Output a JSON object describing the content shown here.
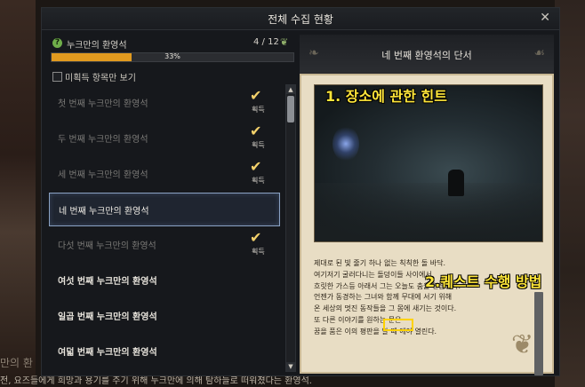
{
  "window": {
    "title": "전체 수집 현황",
    "close_icon": "✕"
  },
  "collection": {
    "name": "누크만의 환영석",
    "count": "4 / 12",
    "progress_percent": 33,
    "progress_text": "33%"
  },
  "filter": {
    "label": "미획득 항목만 보기",
    "checked": false
  },
  "list": {
    "items": [
      {
        "label": "첫 번째 누크만의 환영석",
        "state": "obtained",
        "status": "획득"
      },
      {
        "label": "두 번째 누크만의 환영석",
        "state": "obtained",
        "status": "획득"
      },
      {
        "label": "세 번째 누크만의 환영석",
        "state": "obtained",
        "status": "획득"
      },
      {
        "label": "네 번째 누크만의 환영석",
        "state": "selected",
        "status": ""
      },
      {
        "label": "다섯 번째 누크만의 환영석",
        "state": "obtained",
        "status": "획득"
      },
      {
        "label": "여섯 번째 누크만의 환영석",
        "state": "normal",
        "status": ""
      },
      {
        "label": "일곱 번째 누크만의 환영석",
        "state": "normal",
        "status": ""
      },
      {
        "label": "여덟 번째 누크만의 환영석",
        "state": "normal",
        "status": ""
      }
    ]
  },
  "detail": {
    "title": "네 번째 환영석의 단서",
    "description_lines": [
      "제대로 된 빛 줄기 하나 없는 칙칙한 돌 바닥.",
      "여기저기 굴러다니는 돌덩이들 사이에서",
      "흐릿한 가스등 아래서 그는 오늘도 춤을 연습한다.",
      "언젠가 동경하는 그녀와 함께 무대에 서기 위해",
      "온 세상의 멋진 동작들을 그 몸에 새기는 것이다.",
      "또 다른 이야기를 원하는 문은",
      "꿈을 품은 이의 평판을 알 때 에야 열린다."
    ],
    "highlight_word": "평판을"
  },
  "annotations": {
    "hint_location": "1. 장소에 관한 힌트",
    "quest_method": "2.퀘스트 수행 방법"
  },
  "background": {
    "left_text": "만의 환",
    "bottom_text": "전, 요즈들에게 희망과 용기를 주기 위해 누크만에 의해 탐하늘로 떠워졌다는 환영석."
  }
}
